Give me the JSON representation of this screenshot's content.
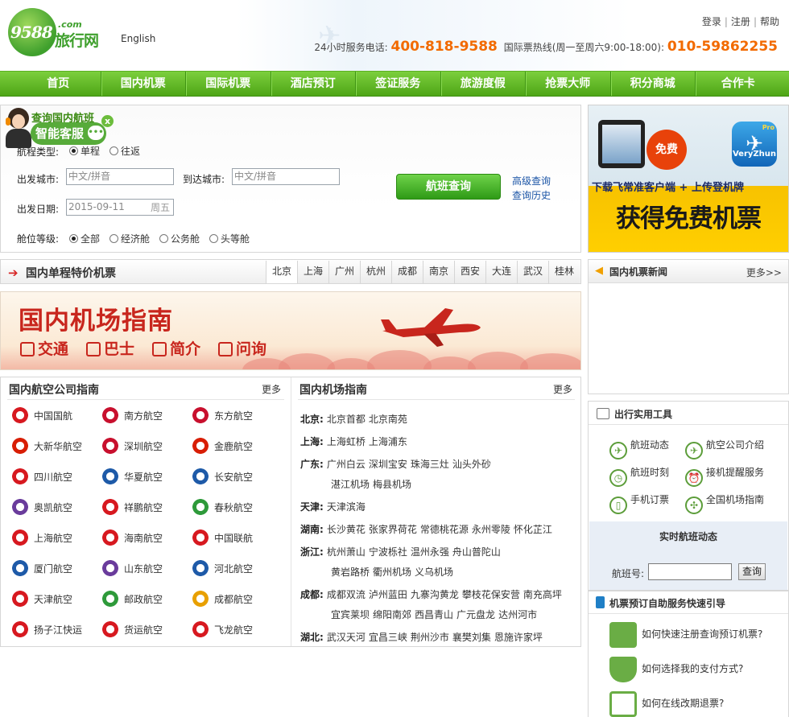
{
  "header": {
    "logo_number": "9588",
    "logo_com": ".com",
    "logo_cn": "旅行网",
    "lang_link": "English",
    "top_links": [
      "登录",
      "注册",
      "帮助"
    ],
    "hotline_label": "24小时服务电话:",
    "hotline_number": "400-818-9588",
    "intl_label": "国际票热线(周一至周六9:00-18:00):",
    "intl_number": "010-59862255"
  },
  "nav": [
    "首页",
    "国内机票",
    "国际机票",
    "酒店预订",
    "签证服务",
    "旅游度假",
    "抢票大师",
    "积分商城",
    "合作卡"
  ],
  "customer_service": {
    "label": "智能客服",
    "chat_icon": "chat-bubble-icon",
    "close": "x"
  },
  "search": {
    "title": "查询国内航班",
    "trip_type_label": "航程类型:",
    "trip_types": [
      "单程",
      "往返"
    ],
    "trip_type_selected": 0,
    "from_label": "出发城市:",
    "from_placeholder": "中文/拼音",
    "to_label": "到达城市:",
    "to_placeholder": "中文/拼音",
    "date_label": "出发日期:",
    "date_value": "2015-09-11",
    "date_weekday": "周五",
    "class_label": "舱位等级:",
    "classes": [
      "全部",
      "经济舱",
      "公务舱",
      "头等舱"
    ],
    "class_selected": 0,
    "search_button": "航班查询",
    "advanced_link": "高级查询",
    "history_link": "查询历史"
  },
  "app_ad": {
    "free_badge": "免费",
    "app_name": "VeryZhun",
    "app_tag": "Pro",
    "line1": "下载飞常准客户端 + 上传登机牌",
    "line2": "获得免费机票"
  },
  "offers": {
    "title": "国内单程特价机票",
    "cities": [
      "北京",
      "上海",
      "广州",
      "杭州",
      "成都",
      "南京",
      "西安",
      "大连",
      "武汉",
      "桂林"
    ],
    "active_city": 0
  },
  "banner": {
    "title": "国内机场指南",
    "links": [
      "交通",
      "巴士",
      "简介",
      "问询"
    ]
  },
  "airline_guide": {
    "title": "国内航空公司指南",
    "more": "更多",
    "airlines": [
      {
        "name": "中国国航",
        "color": "#d71920"
      },
      {
        "name": "南方航空",
        "color": "#c8102e"
      },
      {
        "name": "东方航空",
        "color": "#c8102e"
      },
      {
        "name": "大新华航空",
        "color": "#d81e05"
      },
      {
        "name": "深圳航空",
        "color": "#c8102e"
      },
      {
        "name": "金鹿航空",
        "color": "#d81e05"
      },
      {
        "name": "四川航空",
        "color": "#d71920"
      },
      {
        "name": "华夏航空",
        "color": "#1e5aa8"
      },
      {
        "name": "长安航空",
        "color": "#1e5aa8"
      },
      {
        "name": "奥凯航空",
        "color": "#6a3c9c"
      },
      {
        "name": "祥鹏航空",
        "color": "#d71920"
      },
      {
        "name": "春秋航空",
        "color": "#2e9a3a"
      },
      {
        "name": "上海航空",
        "color": "#d71920"
      },
      {
        "name": "海南航空",
        "color": "#d71920"
      },
      {
        "name": "中国联航",
        "color": "#d71920"
      },
      {
        "name": "厦门航空",
        "color": "#1e5aa8"
      },
      {
        "name": "山东航空",
        "color": "#6a3c9c"
      },
      {
        "name": "河北航空",
        "color": "#1e5aa8"
      },
      {
        "name": "天津航空",
        "color": "#d71920"
      },
      {
        "name": "邮政航空",
        "color": "#2e9a3a"
      },
      {
        "name": "成都航空",
        "color": "#e8a000"
      },
      {
        "name": "扬子江快运",
        "color": "#d71920"
      },
      {
        "name": "货运航空",
        "color": "#d71920"
      },
      {
        "name": "飞龙航空",
        "color": "#d71920"
      }
    ]
  },
  "airport_guide": {
    "title": "国内机场指南",
    "more": "更多",
    "rows": [
      {
        "province": "北京:",
        "airports": [
          "北京首都",
          "北京南苑"
        ]
      },
      {
        "province": "上海:",
        "airports": [
          "上海虹桥",
          "上海浦东"
        ]
      },
      {
        "province": "广东:",
        "airports": [
          "广州白云",
          "深圳宝安",
          "珠海三灶",
          "汕头外砂"
        ]
      },
      {
        "province": "",
        "airports": [
          "湛江机场",
          "梅县机场"
        ]
      },
      {
        "province": "天津:",
        "airports": [
          "天津滨海"
        ]
      },
      {
        "province": "湖南:",
        "airports": [
          "长沙黄花",
          "张家界荷花",
          "常德桃花源",
          "永州零陵",
          "怀化芷江"
        ]
      },
      {
        "province": "浙江:",
        "airports": [
          "杭州萧山",
          "宁波栎社",
          "温州永强",
          "舟山普陀山"
        ]
      },
      {
        "province": "",
        "airports": [
          "黄岩路桥",
          "衢州机场",
          "义乌机场"
        ]
      },
      {
        "province": "成都:",
        "airports": [
          "成都双流",
          "泸州蓝田",
          "九寨沟黄龙",
          "攀枝花保安营",
          "南充高坪"
        ]
      },
      {
        "province": "",
        "airports": [
          "宜宾莱坝",
          "绵阳南郊",
          "西昌青山",
          "广元盘龙",
          "达州河市"
        ]
      },
      {
        "province": "湖北:",
        "airports": [
          "武汉天河",
          "宜昌三峡",
          "荆州沙市",
          "襄樊刘集",
          "恩施许家坪"
        ]
      }
    ]
  },
  "news": {
    "title": "国内机票新闻",
    "more": "更多>>"
  },
  "tools": {
    "title": "出行实用工具",
    "items": [
      {
        "label": "航班动态",
        "icon": "plane-status-icon"
      },
      {
        "label": "航空公司介绍",
        "icon": "airline-intro-icon"
      },
      {
        "label": "航班时刻",
        "icon": "clock-icon"
      },
      {
        "label": "接机提醒服务",
        "icon": "alarm-icon"
      },
      {
        "label": "手机订票",
        "icon": "phone-icon"
      },
      {
        "label": "全国机场指南",
        "icon": "airport-icon"
      }
    ],
    "flight_status_title": "实时航班动态",
    "flight_no_label": "航班号:",
    "query_button": "查询"
  },
  "self_service": {
    "title": "机票预订自助服务快速引导",
    "faqs": [
      "如何快速注册查询预订机票?",
      "如何选择我的支付方式?",
      "如何在线改期退票?"
    ]
  }
}
